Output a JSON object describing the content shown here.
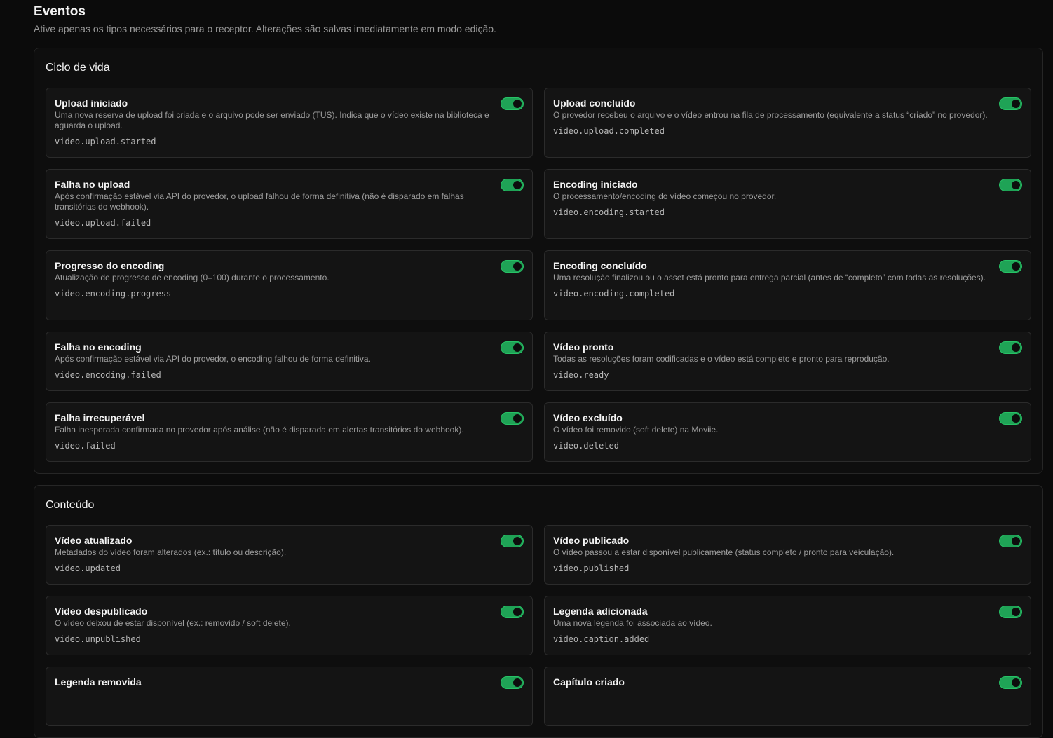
{
  "header": {
    "title": "Eventos",
    "subtitle": "Ative apenas os tipos necessários para o receptor. Alterações são salvas imediatamente em modo edição."
  },
  "colors": {
    "toggle_on": "#1fa356",
    "background": "#0b0b0b"
  },
  "sections": [
    {
      "title": "Ciclo de vida",
      "events": [
        {
          "title": "Upload iniciado",
          "description": "Uma nova reserva de upload foi criada e o arquivo pode ser enviado (TUS). Indica que o vídeo existe na biblioteca e aguarda o upload.",
          "code": "video.upload.started",
          "enabled": true
        },
        {
          "title": "Upload concluído",
          "description": "O provedor recebeu o arquivo e o vídeo entrou na fila de processamento (equivalente a status “criado” no provedor).",
          "code": "video.upload.completed",
          "enabled": true
        },
        {
          "title": "Falha no upload",
          "description": "Após confirmação estável via API do provedor, o upload falhou de forma definitiva (não é disparado em falhas transitórias do webhook).",
          "code": "video.upload.failed",
          "enabled": true
        },
        {
          "title": "Encoding iniciado",
          "description": "O processamento/encoding do vídeo começou no provedor.",
          "code": "video.encoding.started",
          "enabled": true
        },
        {
          "title": "Progresso do encoding",
          "description": "Atualização de progresso de encoding (0–100) durante o processamento.",
          "code": "video.encoding.progress",
          "enabled": true
        },
        {
          "title": "Encoding concluído",
          "description": "Uma resolução finalizou ou o asset está pronto para entrega parcial (antes de “completo” com todas as resoluções).",
          "code": "video.encoding.completed",
          "enabled": true
        },
        {
          "title": "Falha no encoding",
          "description": "Após confirmação estável via API do provedor, o encoding falhou de forma definitiva.",
          "code": "video.encoding.failed",
          "enabled": true
        },
        {
          "title": "Vídeo pronto",
          "description": "Todas as resoluções foram codificadas e o vídeo está completo e pronto para reprodução.",
          "code": "video.ready",
          "enabled": true
        },
        {
          "title": "Falha irrecuperável",
          "description": "Falha inesperada confirmada no provedor após análise (não é disparada em alertas transitórios do webhook).",
          "code": "video.failed",
          "enabled": true
        },
        {
          "title": "Vídeo excluído",
          "description": "O vídeo foi removido (soft delete) na Moviie.",
          "code": "video.deleted",
          "enabled": true
        }
      ]
    },
    {
      "title": "Conteúdo",
      "events": [
        {
          "title": "Vídeo atualizado",
          "description": "Metadados do vídeo foram alterados (ex.: título ou descrição).",
          "code": "video.updated",
          "enabled": true
        },
        {
          "title": "Vídeo publicado",
          "description": "O vídeo passou a estar disponível publicamente (status completo / pronto para veiculação).",
          "code": "video.published",
          "enabled": true
        },
        {
          "title": "Vídeo despublicado",
          "description": "O vídeo deixou de estar disponível (ex.: removido / soft delete).",
          "code": "video.unpublished",
          "enabled": true
        },
        {
          "title": "Legenda adicionada",
          "description": "Uma nova legenda foi associada ao vídeo.",
          "code": "video.caption.added",
          "enabled": true
        },
        {
          "title": "Legenda removida",
          "description": "",
          "code": "",
          "enabled": true
        },
        {
          "title": "Capítulo criado",
          "description": "",
          "code": "",
          "enabled": true
        }
      ]
    }
  ]
}
